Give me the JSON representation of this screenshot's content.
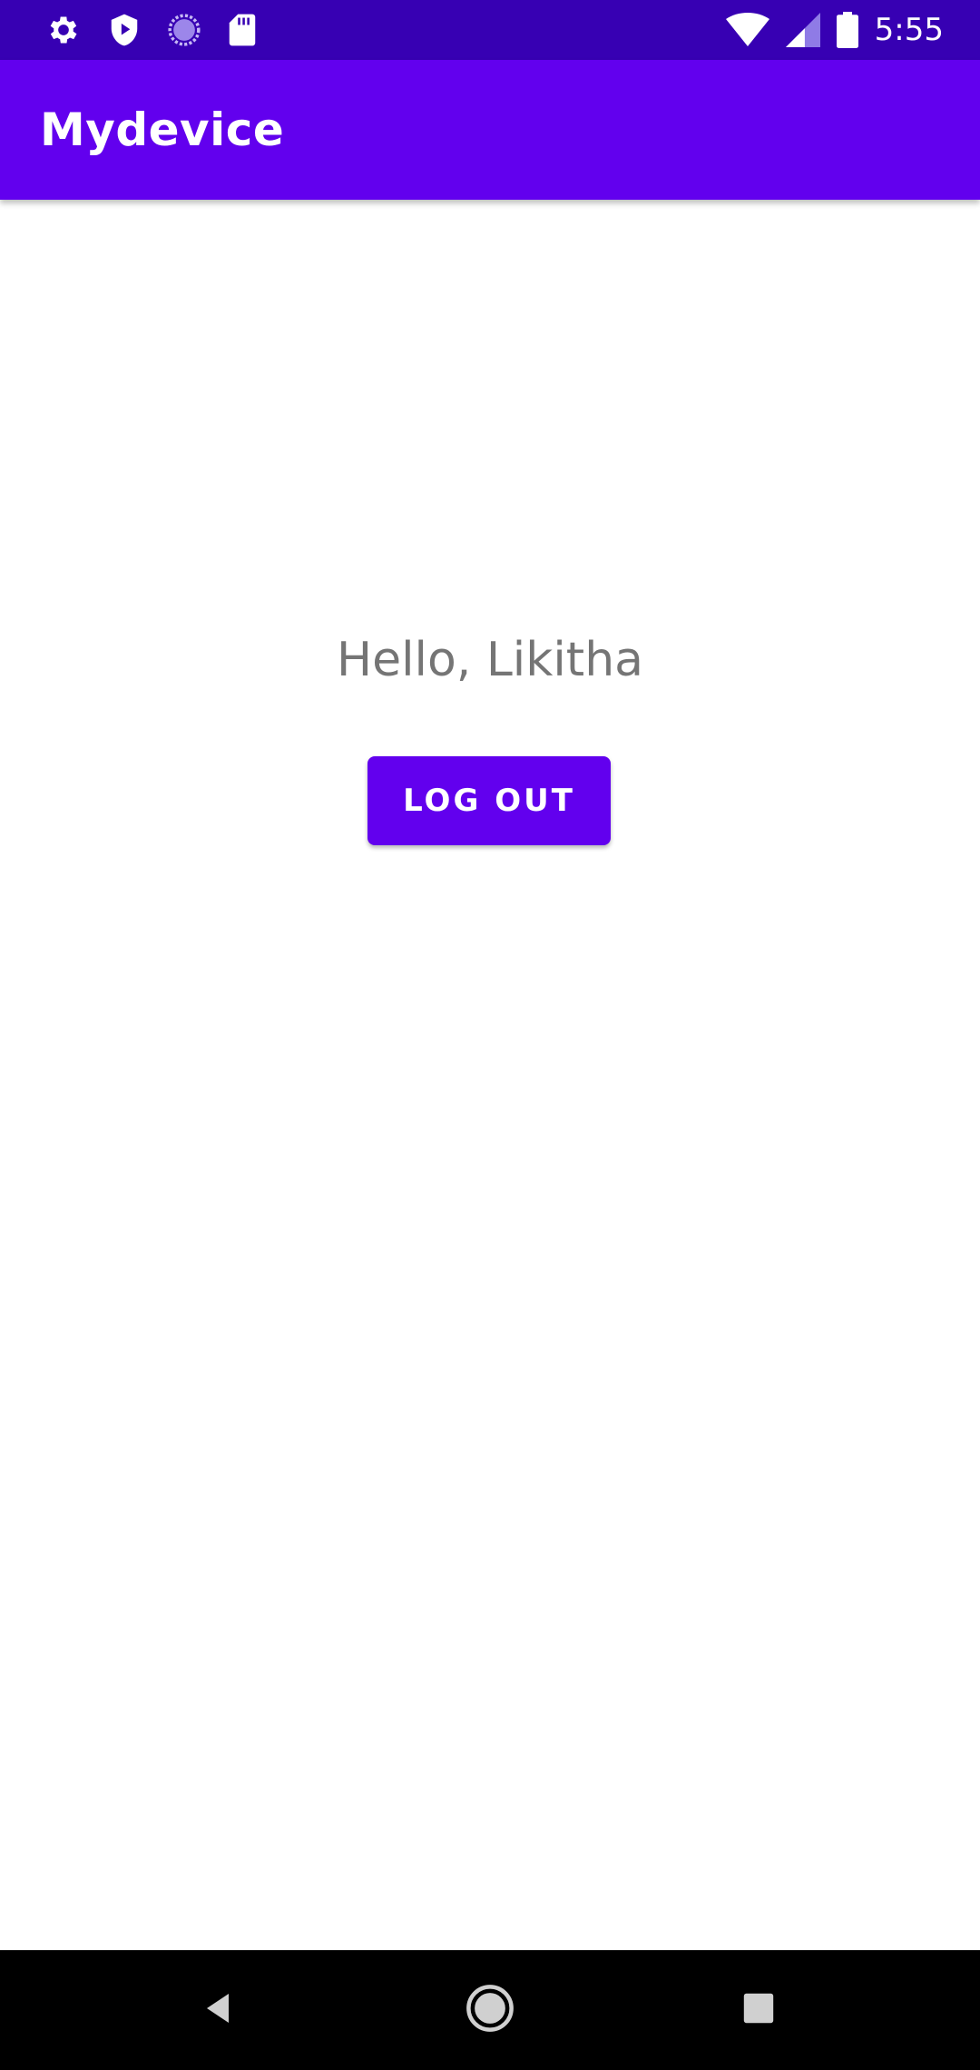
{
  "status_bar": {
    "time": "5:55",
    "left_icons": [
      "settings-icon",
      "shield-play-icon",
      "sync-circle-icon",
      "sd-card-icon"
    ],
    "right_icons": [
      "wifi-icon",
      "cellular-signal-icon",
      "battery-icon"
    ]
  },
  "app_bar": {
    "title": "Mydevice"
  },
  "main": {
    "greeting": "Hello, Likitha",
    "logout_label": "LOG OUT"
  },
  "nav_bar": {
    "icons": [
      "back-icon",
      "home-icon",
      "recents-icon"
    ]
  },
  "colors": {
    "status_bar": "#3700b3",
    "app_bar": "#6200ee",
    "button": "#6200ee",
    "greeting_text": "#757575",
    "nav_bar": "#000000"
  }
}
